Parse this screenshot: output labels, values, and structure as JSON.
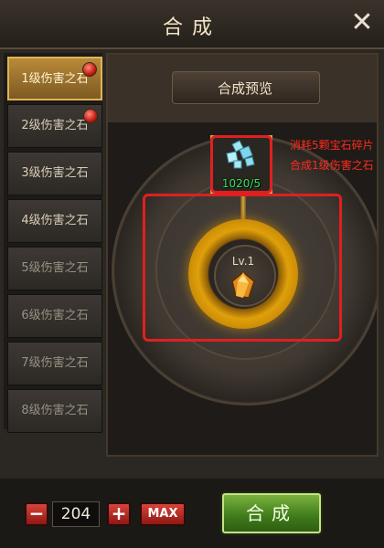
{
  "window": {
    "title": "合成",
    "close_label": "✕"
  },
  "sidebar": {
    "items": [
      {
        "label": "1级伤害之石",
        "state": "selected",
        "badge": true
      },
      {
        "label": "2级伤害之石",
        "state": "normal",
        "badge": true
      },
      {
        "label": "3级伤害之石",
        "state": "normal",
        "badge": false
      },
      {
        "label": "4级伤害之石",
        "state": "normal",
        "badge": false
      },
      {
        "label": "5级伤害之石",
        "state": "dim",
        "badge": false
      },
      {
        "label": "6级伤害之石",
        "state": "dim",
        "badge": false
      },
      {
        "label": "7级伤害之石",
        "state": "dim",
        "badge": false
      },
      {
        "label": "8级伤害之石",
        "state": "dim",
        "badge": false
      }
    ]
  },
  "preview": {
    "header": "合成预览",
    "material_count": "1020/5",
    "result_level": "Lv.1",
    "annotation_line1": "消耗5颗宝石碎片",
    "annotation_line2": "合成1级伤害之石"
  },
  "controls": {
    "minus": "−",
    "quantity": "204",
    "plus": "+",
    "max": "MAX",
    "compose": "合成"
  },
  "colors": {
    "accent_gold": "#e0a00a",
    "annotation_red": "#e02020",
    "count_green": "#35e35f",
    "compose_green": "#3f7a1a"
  }
}
